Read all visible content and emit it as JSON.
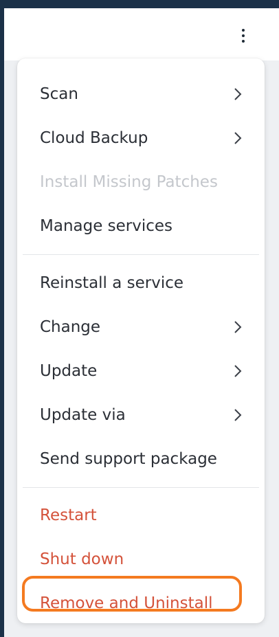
{
  "header": {
    "more_icon": "vertical-ellipsis-icon"
  },
  "menu": {
    "chevron_icon": "chevron-right-icon",
    "groups": [
      {
        "items": [
          {
            "label": "Scan",
            "has_submenu": true
          },
          {
            "label": "Cloud Backup",
            "has_submenu": true
          },
          {
            "label": "Install Missing Patches",
            "disabled": true
          },
          {
            "label": "Manage services"
          }
        ]
      },
      {
        "items": [
          {
            "label": "Reinstall a service"
          },
          {
            "label": "Change",
            "has_submenu": true
          },
          {
            "label": "Update",
            "has_submenu": true
          },
          {
            "label": "Update via",
            "has_submenu": true
          },
          {
            "label": "Send support package"
          }
        ]
      },
      {
        "items": [
          {
            "label": "Restart",
            "danger": true
          },
          {
            "label": "Shut down",
            "danger": true
          },
          {
            "label": "Remove and Uninstall",
            "danger": true,
            "highlighted": true
          }
        ]
      }
    ]
  },
  "colors": {
    "page_background": "#1b3148",
    "text": "#2b2f36",
    "disabled_text": "#c4c7cc",
    "danger_text": "#d4523a",
    "highlight_outline": "#f47a20"
  }
}
